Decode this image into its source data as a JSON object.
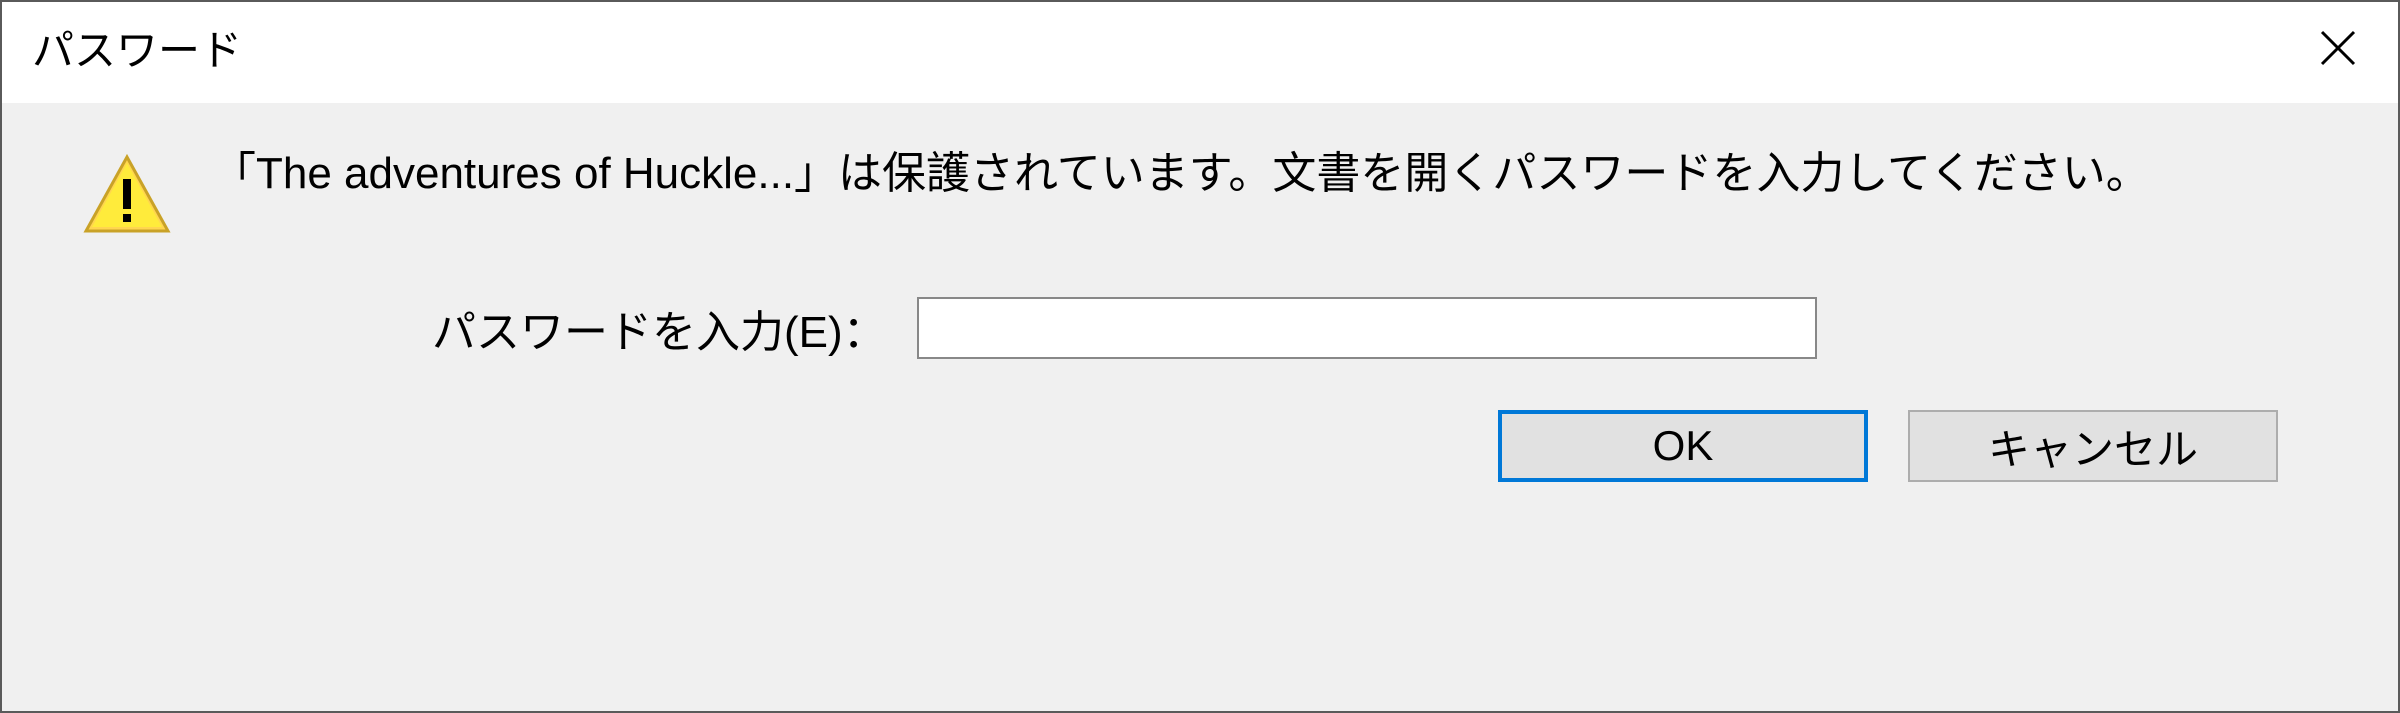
{
  "dialog": {
    "title": "パスワード",
    "message": "「The adventures of Huckle...」は保護されています。文書を開くパスワードを入力してください。",
    "input_label": "パスワードを入力(E)：",
    "input_value": "",
    "ok_label": "OK",
    "cancel_label": "キャンセル"
  }
}
